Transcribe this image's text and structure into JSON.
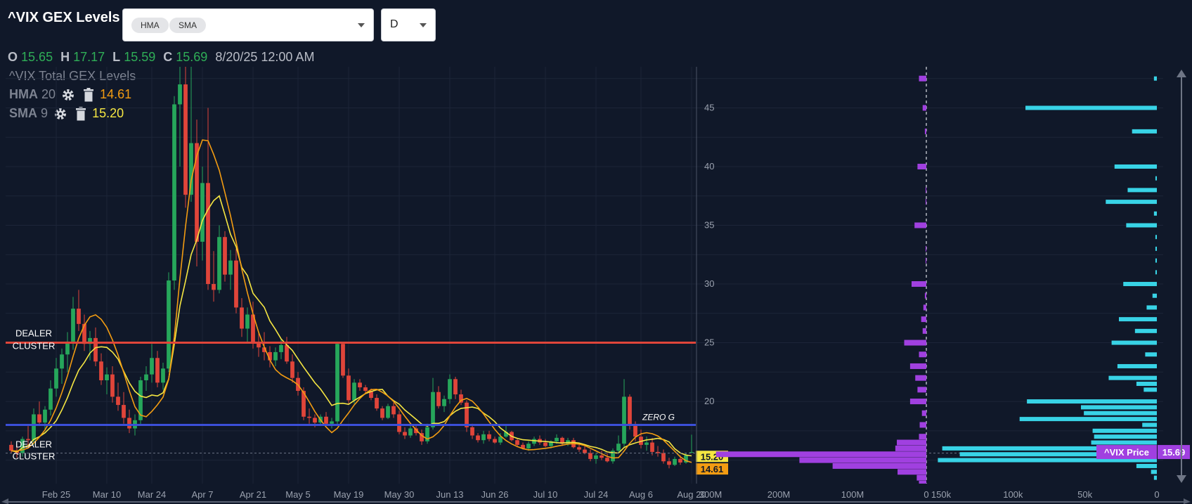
{
  "header": {
    "title": "^VIX GEX Levels",
    "indicator_chips": [
      "HMA",
      "SMA"
    ],
    "timeframe": "D"
  },
  "ohlc": {
    "o_label": "O",
    "o": "15.65",
    "h_label": "H",
    "h": "17.17",
    "l_label": "L",
    "l": "15.59",
    "c_label": "C",
    "c": "15.69",
    "datetime": "8/20/25 12:00 AM"
  },
  "legend": {
    "series_title": "^VIX Total GEX Levels",
    "hma_label": "HMA",
    "hma_period": "20",
    "hma_value": "14.61",
    "sma_label": "SMA",
    "sma_period": "9",
    "sma_value": "15.20"
  },
  "colors": {
    "background": "#101829",
    "candle_up": "#26a65b",
    "candle_down": "#e0453a",
    "hma": "#f39c12",
    "sma": "#f5e642",
    "dealer_cluster_line": "#e0453a",
    "zero_gamma_line": "#3b4fd8",
    "gex_total_bar": "#a040e0",
    "gex_strike_bar": "#38d3e6",
    "price_tag": "#a040e0"
  },
  "chart_data": [
    {
      "type": "line",
      "chart": "candlestick",
      "title": "^VIX Total GEX Levels",
      "x_ticks": [
        "Feb 25",
        "Mar 10",
        "Mar 24",
        "Apr 7",
        "Apr 21",
        "May 5",
        "May 19",
        "May 30",
        "Jun 13",
        "Jun 26",
        "Jul 10",
        "Jul 24",
        "Aug 6",
        "Aug 20"
      ],
      "y_ticks": [
        20,
        25,
        30,
        35,
        40,
        45
      ],
      "ylim": [
        13,
        48.5
      ],
      "candles": [
        [
          16.3,
          16.6,
          15.6,
          15.8
        ],
        [
          15.8,
          16.4,
          15.2,
          15.6
        ],
        [
          15.6,
          17.0,
          15.3,
          16.8
        ],
        [
          16.8,
          17.9,
          16.1,
          16.7
        ],
        [
          16.7,
          19.4,
          16.3,
          18.9
        ],
        [
          18.9,
          20.0,
          17.9,
          18.2
        ],
        [
          18.2,
          19.6,
          17.6,
          19.3
        ],
        [
          19.3,
          21.8,
          18.8,
          21.1
        ],
        [
          21.1,
          23.7,
          20.4,
          22.8
        ],
        [
          22.8,
          24.5,
          21.5,
          24.0
        ],
        [
          24.0,
          25.9,
          22.5,
          25.1
        ],
        [
          25.1,
          28.9,
          24.4,
          27.9
        ],
        [
          27.9,
          29.5,
          26.0,
          26.6
        ],
        [
          26.6,
          27.4,
          24.3,
          24.9
        ],
        [
          24.9,
          26.0,
          23.5,
          25.4
        ],
        [
          25.4,
          26.3,
          23.0,
          23.4
        ],
        [
          23.4,
          24.1,
          21.4,
          21.8
        ],
        [
          21.8,
          22.9,
          20.6,
          22.3
        ],
        [
          22.3,
          23.0,
          19.9,
          20.4
        ],
        [
          20.4,
          21.6,
          19.2,
          19.7
        ],
        [
          19.7,
          20.8,
          18.1,
          18.6
        ],
        [
          18.6,
          19.3,
          17.3,
          17.7
        ],
        [
          17.7,
          18.9,
          17.1,
          18.4
        ],
        [
          18.4,
          22.1,
          18.0,
          21.8
        ],
        [
          21.8,
          23.0,
          20.9,
          22.3
        ],
        [
          22.3,
          24.9,
          21.6,
          23.7
        ],
        [
          23.7,
          24.3,
          21.2,
          21.6
        ],
        [
          21.6,
          23.3,
          21.0,
          22.8
        ],
        [
          22.8,
          31.0,
          22.5,
          30.3
        ],
        [
          30.3,
          46.0,
          29.5,
          45.3
        ],
        [
          45.3,
          60.0,
          40.0,
          47.0
        ],
        [
          47.0,
          52.0,
          36.5,
          37.6
        ],
        [
          37.6,
          48.5,
          37.0,
          42.0
        ],
        [
          42.0,
          44.0,
          31.5,
          33.6
        ],
        [
          33.6,
          40.0,
          32.0,
          38.6
        ],
        [
          38.6,
          45.0,
          29.5,
          30.0
        ],
        [
          30.0,
          32.8,
          28.5,
          29.5
        ],
        [
          29.5,
          35.0,
          29.2,
          34.0
        ],
        [
          34.0,
          34.5,
          30.2,
          30.8
        ],
        [
          30.8,
          32.9,
          29.5,
          32.0
        ],
        [
          32.0,
          33.0,
          27.5,
          28.0
        ],
        [
          28.0,
          28.8,
          25.5,
          26.2
        ],
        [
          26.2,
          28.0,
          25.0,
          27.4
        ],
        [
          27.4,
          28.5,
          24.5,
          25.0
        ],
        [
          25.0,
          25.8,
          23.8,
          24.6
        ],
        [
          24.6,
          25.9,
          23.5,
          24.2
        ],
        [
          24.2,
          24.7,
          22.9,
          23.5
        ],
        [
          23.5,
          24.6,
          23.0,
          24.2
        ],
        [
          24.2,
          25.3,
          23.6,
          24.8
        ],
        [
          24.8,
          25.5,
          23.2,
          23.4
        ],
        [
          23.4,
          24.0,
          21.6,
          22.0
        ],
        [
          22.0,
          22.5,
          20.5,
          20.9
        ],
        [
          20.9,
          21.2,
          18.4,
          18.7
        ],
        [
          18.7,
          19.4,
          18.1,
          18.6
        ],
        [
          18.6,
          18.9,
          17.8,
          18.2
        ],
        [
          18.2,
          18.9,
          17.9,
          18.7
        ],
        [
          18.7,
          19.1,
          17.9,
          18.1
        ],
        [
          18.1,
          18.6,
          17.7,
          18.3
        ],
        [
          18.3,
          25.1,
          17.9,
          24.9
        ],
        [
          24.9,
          25.0,
          22.0,
          22.2
        ],
        [
          22.2,
          22.8,
          19.7,
          20.1
        ],
        [
          20.1,
          21.9,
          19.8,
          21.6
        ],
        [
          21.6,
          21.9,
          20.9,
          21.2
        ],
        [
          21.2,
          21.4,
          20.7,
          20.9
        ],
        [
          20.9,
          21.1,
          20.1,
          20.3
        ],
        [
          20.3,
          20.6,
          19.2,
          19.4
        ],
        [
          19.4,
          19.6,
          18.4,
          18.6
        ],
        [
          18.6,
          19.8,
          18.5,
          19.6
        ],
        [
          19.6,
          19.9,
          18.6,
          18.9
        ],
        [
          18.9,
          19.2,
          17.2,
          17.4
        ],
        [
          17.4,
          17.8,
          16.8,
          17.1
        ],
        [
          17.1,
          17.9,
          16.9,
          17.7
        ],
        [
          17.7,
          17.9,
          17.1,
          17.3
        ],
        [
          17.3,
          17.6,
          16.3,
          16.6
        ],
        [
          16.6,
          18.1,
          16.4,
          17.8
        ],
        [
          17.8,
          22.0,
          17.6,
          20.8
        ],
        [
          20.8,
          21.3,
          19.4,
          19.6
        ],
        [
          19.6,
          20.5,
          19.1,
          20.2
        ],
        [
          20.2,
          22.3,
          19.8,
          21.9
        ],
        [
          21.9,
          22.1,
          20.2,
          20.6
        ],
        [
          20.6,
          21.0,
          19.7,
          19.9
        ],
        [
          19.9,
          20.1,
          17.4,
          17.8
        ],
        [
          17.8,
          18.1,
          16.8,
          17.1
        ],
        [
          17.1,
          17.3,
          16.5,
          16.7
        ],
        [
          16.7,
          17.5,
          16.4,
          17.2
        ],
        [
          17.2,
          17.5,
          16.6,
          16.8
        ],
        [
          16.8,
          17.0,
          16.4,
          16.5
        ],
        [
          16.5,
          17.3,
          16.3,
          17.0
        ],
        [
          17.0,
          17.9,
          16.9,
          17.4
        ],
        [
          17.4,
          17.5,
          16.6,
          16.7
        ],
        [
          16.7,
          16.9,
          16.1,
          16.3
        ],
        [
          16.3,
          16.5,
          15.9,
          16.0
        ],
        [
          16.0,
          16.6,
          15.8,
          16.4
        ],
        [
          16.4,
          17.0,
          16.2,
          16.8
        ],
        [
          16.8,
          17.1,
          16.3,
          16.5
        ],
        [
          16.5,
          16.8,
          16.1,
          16.2
        ],
        [
          16.2,
          16.7,
          16.0,
          16.6
        ],
        [
          16.6,
          17.2,
          16.4,
          16.9
        ],
        [
          16.9,
          17.0,
          16.2,
          16.4
        ],
        [
          16.4,
          16.9,
          16.2,
          16.7
        ],
        [
          16.7,
          16.9,
          16.0,
          16.1
        ],
        [
          16.1,
          16.4,
          15.7,
          15.9
        ],
        [
          15.9,
          16.3,
          15.5,
          15.6
        ],
        [
          15.6,
          15.9,
          14.9,
          15.1
        ],
        [
          15.1,
          15.6,
          14.7,
          15.4
        ],
        [
          15.4,
          15.8,
          15.0,
          15.2
        ],
        [
          15.2,
          15.6,
          14.8,
          14.9
        ],
        [
          14.9,
          16.0,
          14.7,
          15.8
        ],
        [
          15.8,
          17.1,
          15.6,
          16.4
        ],
        [
          16.4,
          21.9,
          16.1,
          20.4
        ],
        [
          20.4,
          20.6,
          17.6,
          18.0
        ],
        [
          18.0,
          18.3,
          16.6,
          17.0
        ],
        [
          17.0,
          17.6,
          16.0,
          16.3
        ],
        [
          16.3,
          17.0,
          15.8,
          16.5
        ],
        [
          16.5,
          16.9,
          15.4,
          15.7
        ],
        [
          15.7,
          16.2,
          15.3,
          15.6
        ],
        [
          15.6,
          15.9,
          14.7,
          14.9
        ],
        [
          14.9,
          15.2,
          14.3,
          14.6
        ],
        [
          14.6,
          15.3,
          14.5,
          15.1
        ],
        [
          15.1,
          15.4,
          14.6,
          14.8
        ],
        [
          14.8,
          15.6,
          14.7,
          15.4
        ],
        [
          15.65,
          17.17,
          15.59,
          15.69
        ]
      ],
      "series": [
        {
          "name": "HMA",
          "period": 20,
          "last": 14.61
        },
        {
          "name": "SMA",
          "period": 9,
          "last": 15.2
        }
      ],
      "levels": [
        {
          "label_lines": [
            "DEALER",
            "CLUSTER"
          ],
          "value": 25.0
        },
        {
          "label": "ZERO G",
          "value": 18.0
        },
        {
          "label_lines": [
            "DEALER",
            "CLUSTER"
          ],
          "value": 15.6
        }
      ],
      "price_tags": [
        {
          "text": "15.20",
          "value": 15.2
        },
        {
          "text": "14.61",
          "value": 14.61
        }
      ]
    },
    {
      "type": "bar",
      "title": "",
      "orientation": "horizontal",
      "x_ticks": [
        "300M",
        "200M",
        "100M",
        "0"
      ],
      "xlim": [
        0,
        300000000
      ],
      "bars": [
        {
          "strike": 47.5,
          "value": 10000000
        },
        {
          "strike": 45,
          "value": 5000000
        },
        {
          "strike": 43,
          "value": 2000000
        },
        {
          "strike": 40,
          "value": 12000000
        },
        {
          "strike": 38,
          "value": 1000000
        },
        {
          "strike": 37,
          "value": 1000000
        },
        {
          "strike": 35,
          "value": 16000000
        },
        {
          "strike": 33,
          "value": 1000000
        },
        {
          "strike": 32,
          "value": 1000000
        },
        {
          "strike": 30,
          "value": 20000000
        },
        {
          "strike": 29,
          "value": 2000000
        },
        {
          "strike": 28,
          "value": 4000000
        },
        {
          "strike": 27,
          "value": 7000000
        },
        {
          "strike": 26,
          "value": 5000000
        },
        {
          "strike": 25,
          "value": 30000000
        },
        {
          "strike": 24,
          "value": 10000000
        },
        {
          "strike": 23,
          "value": 22000000
        },
        {
          "strike": 22,
          "value": 15000000
        },
        {
          "strike": 21,
          "value": 12000000
        },
        {
          "strike": 20,
          "value": 22000000
        },
        {
          "strike": 19,
          "value": 6000000
        },
        {
          "strike": 18,
          "value": 9000000
        },
        {
          "strike": 17,
          "value": 10000000
        },
        {
          "strike": 16.5,
          "value": 40000000
        },
        {
          "strike": 16,
          "value": 42000000
        },
        {
          "strike": 15.5,
          "value": 285000000
        },
        {
          "strike": 15,
          "value": 172000000
        },
        {
          "strike": 14.5,
          "value": 127000000
        },
        {
          "strike": 14,
          "value": 39000000
        },
        {
          "strike": 13.5,
          "value": 13000000
        },
        {
          "strike": 13,
          "value": 10000000
        }
      ]
    },
    {
      "type": "bar",
      "title": "",
      "orientation": "horizontal",
      "x_ticks": [
        "150k",
        "100k",
        "50k",
        "0"
      ],
      "xlim": [
        0,
        155000
      ],
      "bars": [
        {
          "strike": 47.5,
          "value": 2000
        },
        {
          "strike": 45,
          "value": 90000
        },
        {
          "strike": 43,
          "value": 17000
        },
        {
          "strike": 40,
          "value": 29000
        },
        {
          "strike": 39,
          "value": 1000
        },
        {
          "strike": 38,
          "value": 20000
        },
        {
          "strike": 37,
          "value": 35000
        },
        {
          "strike": 36,
          "value": 2000
        },
        {
          "strike": 35,
          "value": 21000
        },
        {
          "strike": 34,
          "value": 1000
        },
        {
          "strike": 33,
          "value": 1000
        },
        {
          "strike": 32,
          "value": 1000
        },
        {
          "strike": 31,
          "value": 1000
        },
        {
          "strike": 30,
          "value": 23000
        },
        {
          "strike": 29,
          "value": 3000
        },
        {
          "strike": 28,
          "value": 7000
        },
        {
          "strike": 27,
          "value": 26000
        },
        {
          "strike": 26,
          "value": 15000
        },
        {
          "strike": 25,
          "value": 31000
        },
        {
          "strike": 24,
          "value": 8000
        },
        {
          "strike": 23,
          "value": 27000
        },
        {
          "strike": 22,
          "value": 33000
        },
        {
          "strike": 21.5,
          "value": 14000
        },
        {
          "strike": 21,
          "value": 9000
        },
        {
          "strike": 20,
          "value": 89000
        },
        {
          "strike": 19.5,
          "value": 52000
        },
        {
          "strike": 19,
          "value": 50000
        },
        {
          "strike": 18.5,
          "value": 94000
        },
        {
          "strike": 18,
          "value": 10000
        },
        {
          "strike": 17.5,
          "value": 44000
        },
        {
          "strike": 17,
          "value": 43000
        },
        {
          "strike": 16.5,
          "value": 45000
        },
        {
          "strike": 16,
          "value": 147000
        },
        {
          "strike": 15.5,
          "value": 135000
        },
        {
          "strike": 15,
          "value": 150000
        },
        {
          "strike": 14.5,
          "value": 14000
        },
        {
          "strike": 14,
          "value": 4000
        },
        {
          "strike": 13.5,
          "value": 2000
        }
      ],
      "price_marker": {
        "label": "^VIX Price",
        "value_text": "15.69",
        "value": 15.69
      }
    }
  ]
}
